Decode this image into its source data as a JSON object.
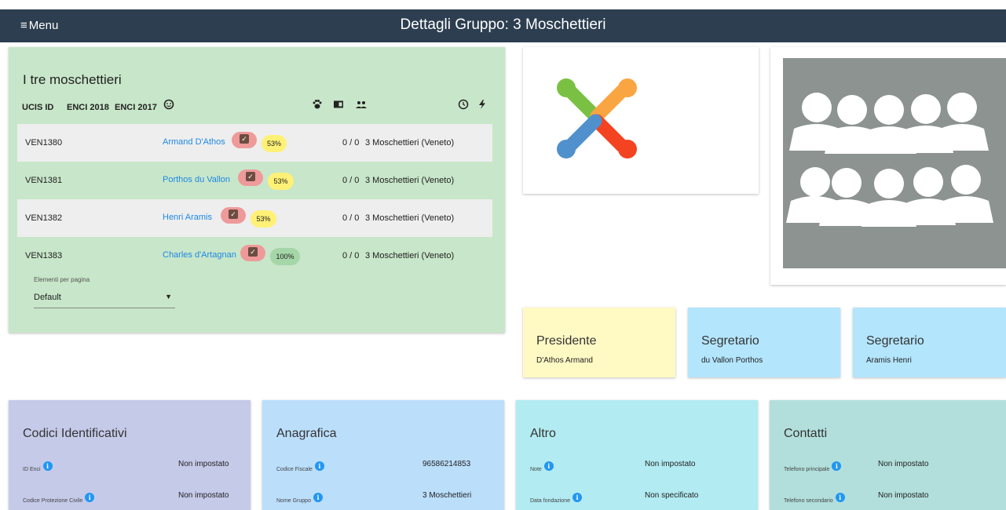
{
  "header": {
    "menu_icon": "≡",
    "menu_label": "Menu",
    "title": "Dettagli Gruppo: 3 Moschettieri"
  },
  "members": {
    "title": "I tre moschettieri",
    "columns": {
      "ucis_id": "UCIS ID",
      "enci_2018": "ENCI 2018",
      "enci_2017": "ENCI 2017"
    },
    "header_icons": [
      "face-icon",
      "paw-icon",
      "id-card-icon",
      "people-icon",
      "clock-icon",
      "bolt-icon"
    ],
    "rows": [
      {
        "id": "VEN1380",
        "name": "Armand D'Athos",
        "percent": "53%",
        "score": "0 / 0",
        "group": "3 Moschettieri (Veneto)"
      },
      {
        "id": "VEN1381",
        "name": "Porthos du Vallon",
        "percent": "53%",
        "score": "0 / 0",
        "group": "3 Moschettieri (Veneto)"
      },
      {
        "id": "VEN1382",
        "name": "Henri Aramis",
        "percent": "53%",
        "score": "0 / 0",
        "group": "3 Moschettieri (Veneto)"
      },
      {
        "id": "VEN1383",
        "name": "Charles d'Artagnan",
        "percent": "100%",
        "score": "0 / 0",
        "group": "3 Moschettieri (Veneto)"
      }
    ],
    "per_page_label": "Elementi per pagina",
    "per_page_value": "Default"
  },
  "logo": {
    "icon": "joomla-logo"
  },
  "photo": {
    "icon": "group-photo"
  },
  "roles": [
    {
      "title": "Presidente",
      "name": "D'Athos Armand",
      "color": "#fff9c4"
    },
    {
      "title": "Segretario",
      "name": "du Vallon Porthos",
      "color": "#b3e5fc"
    },
    {
      "title": "Segretario",
      "name": "Aramis Henri",
      "color": "#b3e5fc"
    }
  ],
  "info_cards": [
    {
      "title": "Codici Identificativi",
      "color": "#c5cae9",
      "rows": [
        {
          "label": "ID Enci",
          "value": "Non impostato"
        },
        {
          "label": "Codice Protezione Civile",
          "value": "Non impostato"
        }
      ]
    },
    {
      "title": "Anagrafica",
      "color": "#bbdefb",
      "rows": [
        {
          "label": "Codice Fiscale",
          "value": "96586214853"
        },
        {
          "label": "Nome Gruppo",
          "value": "3 Moschettieri"
        }
      ]
    },
    {
      "title": "Altro",
      "color": "#b2ebf2",
      "rows": [
        {
          "label": "Note",
          "value": "Non impostato"
        },
        {
          "label": "Data fondazione",
          "value": "Non specificato"
        }
      ]
    },
    {
      "title": "Contatti",
      "color": "#b2dfdb",
      "rows": [
        {
          "label": "Telefono principale",
          "value": "Non impostato"
        },
        {
          "label": "Telefono secondario",
          "value": "Non impostato"
        }
      ]
    }
  ],
  "colors": {
    "header_bg": "#2c3e50",
    "members_bg": "#c8e6c9",
    "link": "#1e88e5",
    "info_icon": "#2196f3"
  }
}
